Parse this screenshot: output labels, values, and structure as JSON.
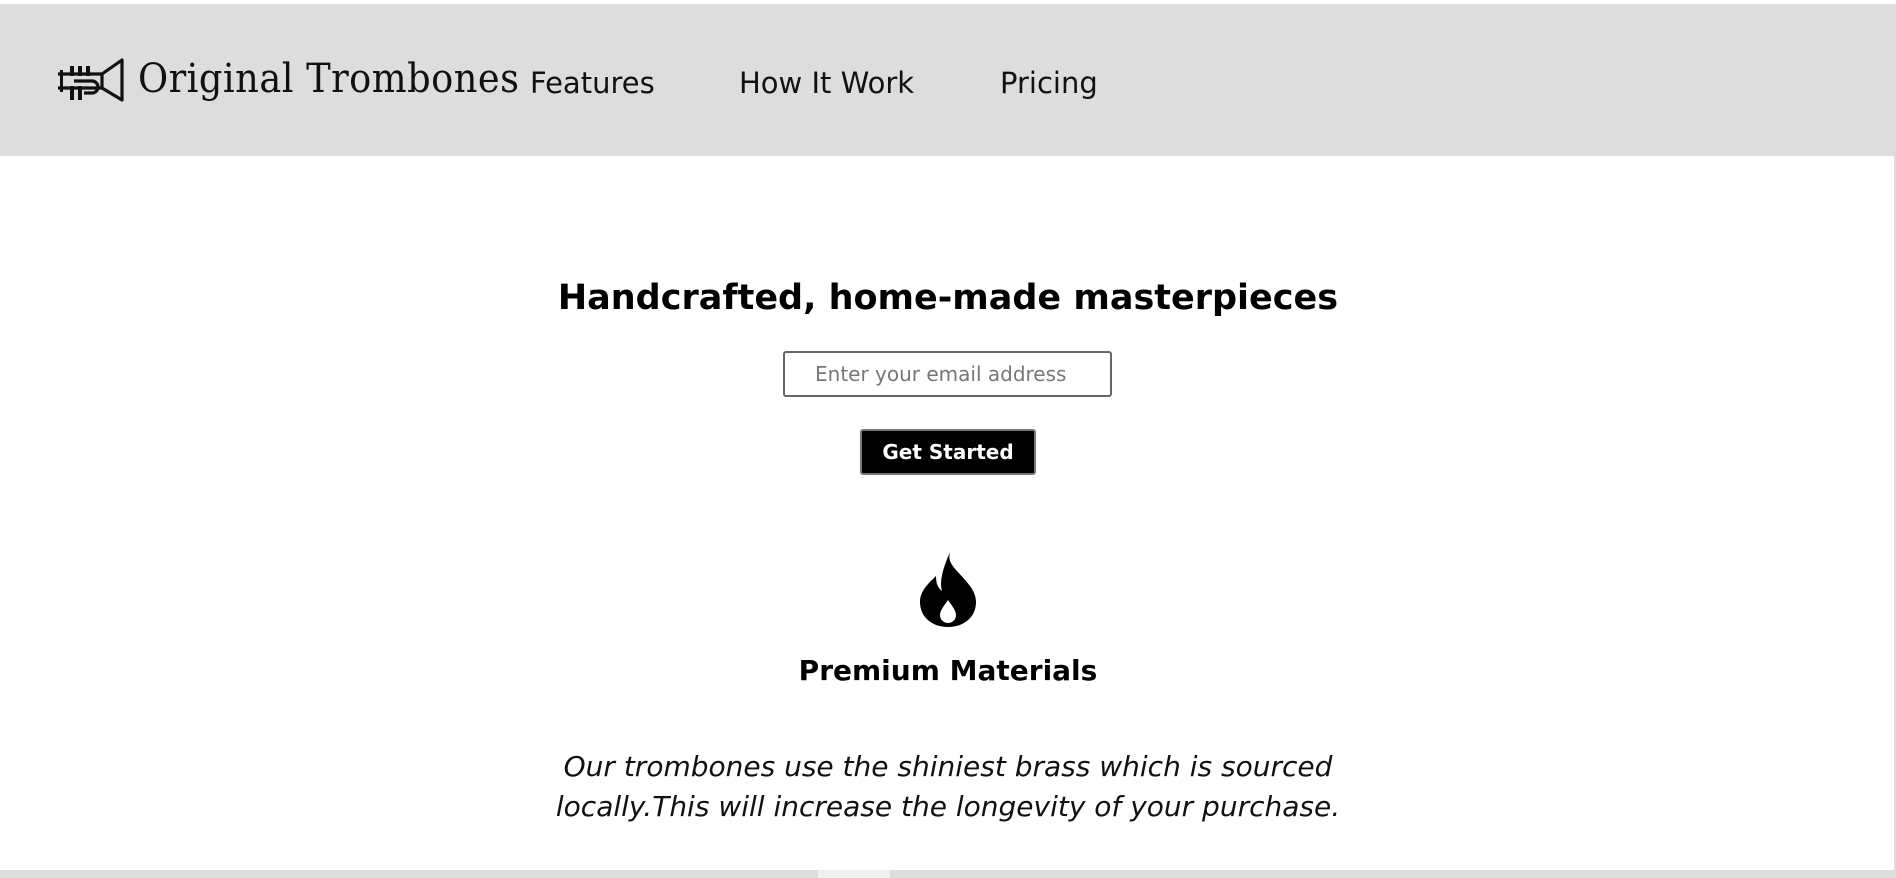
{
  "header": {
    "brand": "Original Trombones",
    "nav": [
      {
        "label": "Features"
      },
      {
        "label": "How It Work"
      },
      {
        "label": "Pricing"
      }
    ]
  },
  "hero": {
    "title": "Handcrafted, home-made masterpieces",
    "email_placeholder": "Enter your email address",
    "email_value": "",
    "cta_label": "Get Started"
  },
  "feature": {
    "icon": "flame-icon",
    "title": "Premium Materials",
    "description": "Our trombones use the shiniest brass which is sourced locally.This will increase the longevity of your purchase."
  },
  "colors": {
    "header_bg": "#dddddd",
    "button_bg": "#000000",
    "button_text": "#ffffff"
  }
}
